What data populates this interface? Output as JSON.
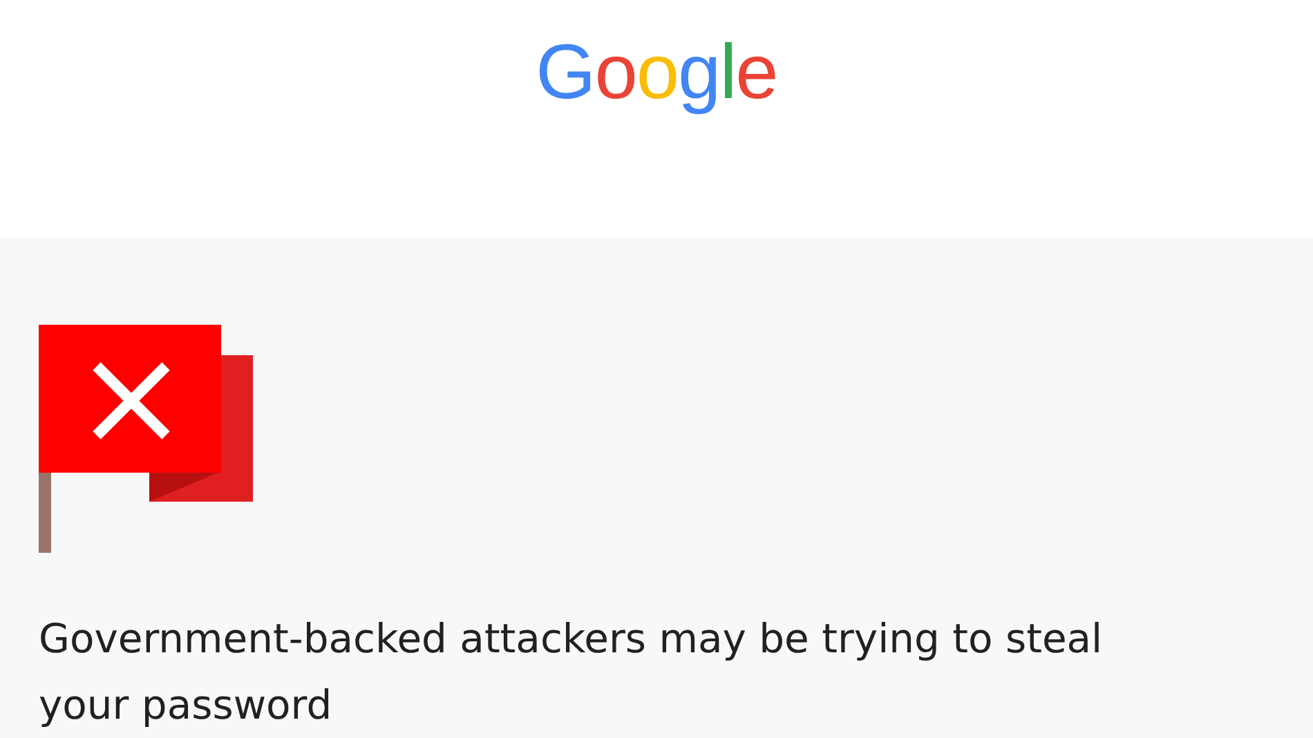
{
  "header": {
    "logo": "Google"
  },
  "alert": {
    "message": "Government-backed attackers may be trying to steal your password"
  }
}
